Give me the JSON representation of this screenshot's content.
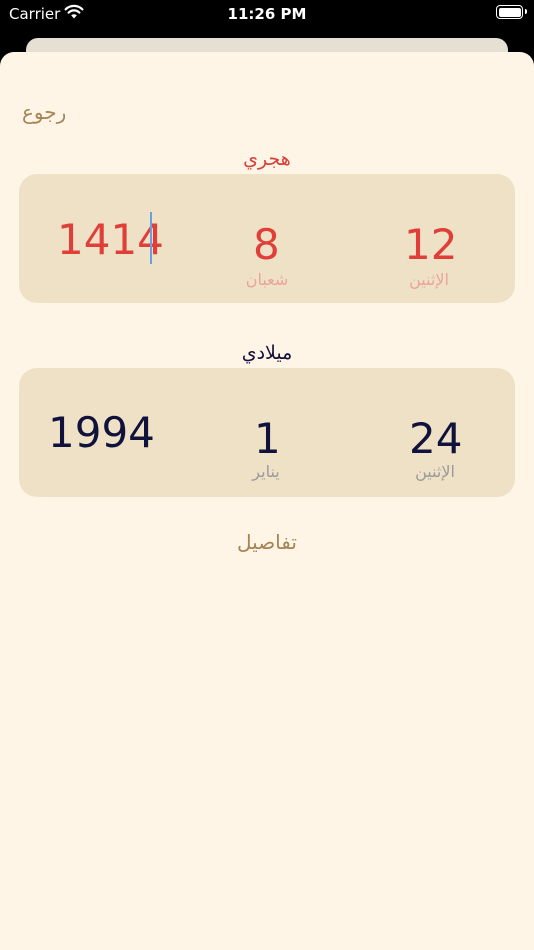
{
  "status_bar": {
    "carrier": "Carrier",
    "time": "11:26 PM"
  },
  "back": {
    "label": "رجوع"
  },
  "hijri": {
    "title": "هجري",
    "year": "1414",
    "month_number": "8",
    "month_name": "شعبان",
    "day_number": "12",
    "weekday": "الإثنين"
  },
  "gregorian": {
    "title": "ميلادي",
    "year": "1994",
    "month_number": "1",
    "month_name": "يناير",
    "day_number": "24",
    "weekday": "الإثنين"
  },
  "details": {
    "label": "تفاصيل"
  },
  "colors": {
    "background": "#fef5e7",
    "card": "#efe1c5",
    "hijri_accent": "#df3e39",
    "gregorian_accent": "#11123c",
    "link": "#a58455"
  }
}
